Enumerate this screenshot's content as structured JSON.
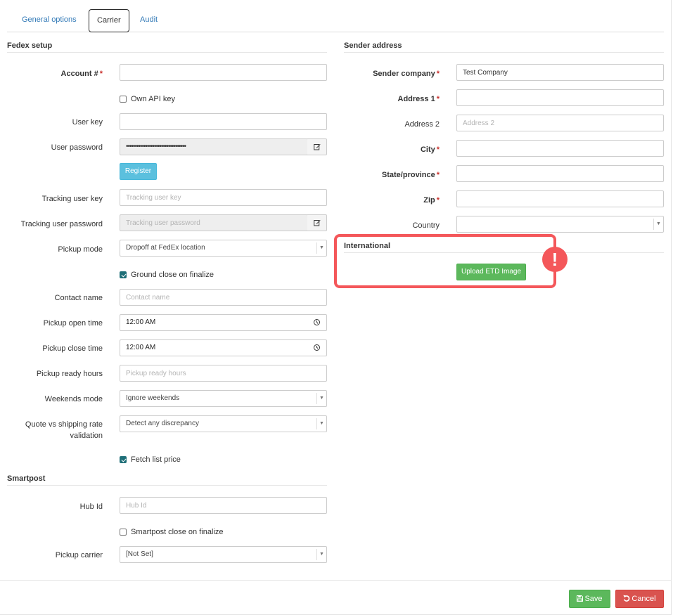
{
  "tabs": [
    {
      "label": "General options"
    },
    {
      "label": "Carrier"
    },
    {
      "label": "Audit"
    }
  ],
  "fedex": {
    "title": "Fedex setup",
    "account_label": "Account #",
    "account_value": "",
    "own_api_key_label": "Own API key",
    "own_api_key_checked": false,
    "user_key_label": "User key",
    "user_key_value": "",
    "user_password_label": "User password",
    "user_password_value": "••••••••••••••••••••••••••••••••••",
    "register_label": "Register",
    "tracking_user_key_label": "Tracking user key",
    "tracking_user_key_placeholder": "Tracking user key",
    "tracking_user_password_label": "Tracking user password",
    "tracking_user_password_placeholder": "Tracking user password",
    "pickup_mode_label": "Pickup mode",
    "pickup_mode_value": "Dropoff at FedEx location",
    "ground_close_label": "Ground close on finalize",
    "ground_close_checked": true,
    "contact_name_label": "Contact name",
    "contact_name_placeholder": "Contact name",
    "pickup_open_label": "Pickup open time",
    "pickup_open_value": "12:00 AM",
    "pickup_close_label": "Pickup close time",
    "pickup_close_value": "12:00 AM",
    "pickup_ready_label": "Pickup ready hours",
    "pickup_ready_placeholder": "Pickup ready hours",
    "weekends_label": "Weekends mode",
    "weekends_value": "Ignore weekends",
    "quote_label_1": "Quote vs shipping rate",
    "quote_label_2": "validation",
    "quote_value": "Detect any discrepancy",
    "fetch_list_price_label": "Fetch list price",
    "fetch_list_price_checked": true
  },
  "smartpost": {
    "title": "Smartpost",
    "hub_id_label": "Hub Id",
    "hub_id_placeholder": "Hub Id",
    "close_on_finalize_label": "Smartpost close on finalize",
    "close_on_finalize_checked": false,
    "pickup_carrier_label": "Pickup carrier",
    "pickup_carrier_value": "[Not Set]"
  },
  "sender": {
    "title": "Sender address",
    "company_label": "Sender company",
    "company_value": "Test Company",
    "address1_label": "Address 1",
    "address1_value": "",
    "address2_label": "Address 2",
    "address2_placeholder": "Address 2",
    "city_label": "City",
    "city_value": "",
    "state_label": "State/province",
    "state_value": "",
    "zip_label": "Zip",
    "zip_value": "",
    "country_label": "Country",
    "country_value": ""
  },
  "international": {
    "title": "International",
    "upload_label": "Upload ETD Image",
    "alert_symbol": "!"
  },
  "footer": {
    "save_label": "Save",
    "cancel_label": "Cancel"
  },
  "colors": {
    "link": "#337ab7",
    "required": "#c9302c",
    "highlight": "#f4575a",
    "success": "#5cb85c",
    "danger": "#d9534f",
    "info": "#5bc0de"
  },
  "icons": {
    "edit": "edit-icon",
    "clock": "clock-icon",
    "save": "save-icon",
    "undo": "undo-icon",
    "dropdown": "chevron-down-icon"
  }
}
